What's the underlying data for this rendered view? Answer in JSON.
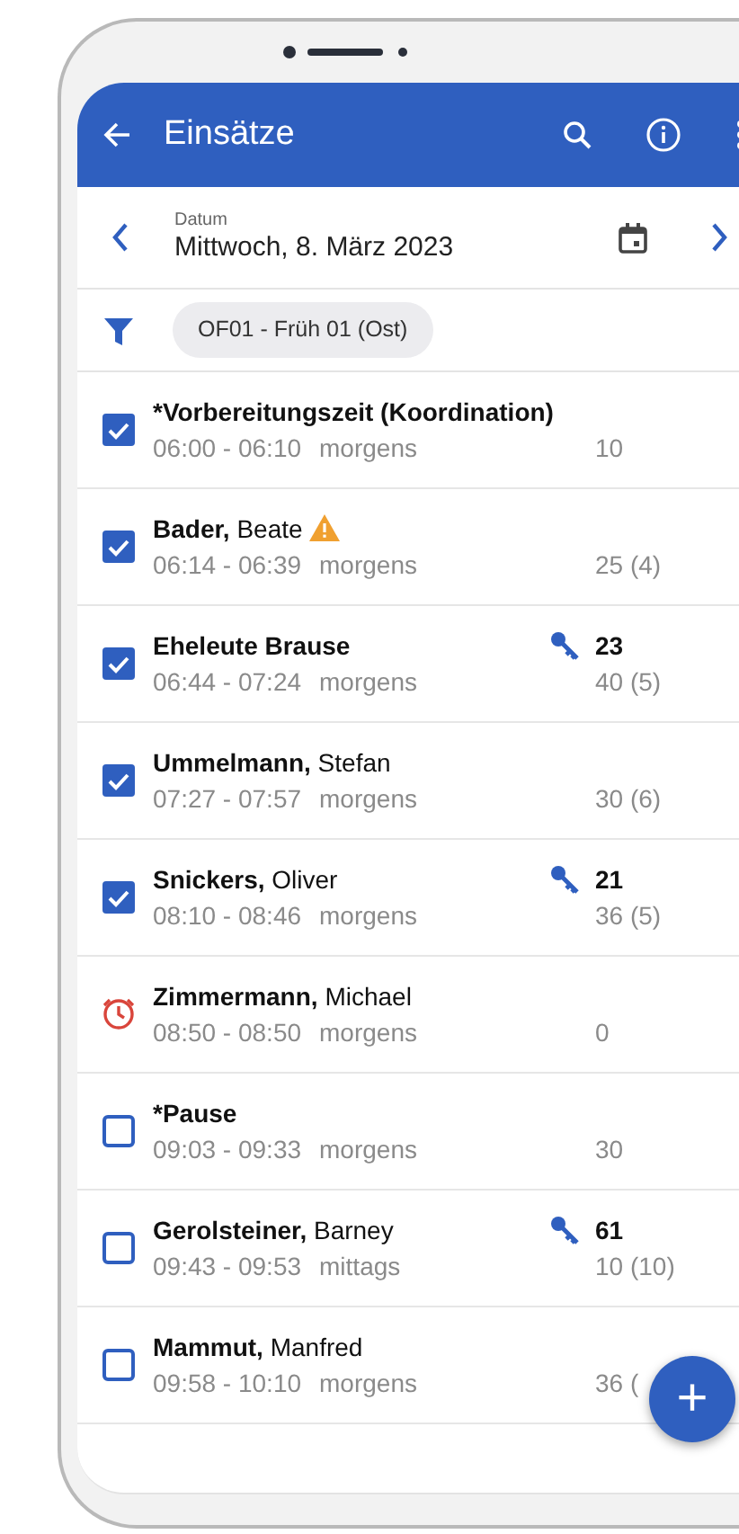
{
  "app_bar": {
    "title": "Einsätze"
  },
  "date_bar": {
    "label": "Datum",
    "value": "Mittwoch, 8. März 2023"
  },
  "filter": {
    "chip": "OF01 - Früh 01 (Ost)"
  },
  "items": [
    {
      "kind": "checkbox",
      "checked": true,
      "surname": "*Vorbereitungszeit (Koordination)",
      "time": "06:00 - 06:10",
      "period": "morgens",
      "duration": "10"
    },
    {
      "kind": "checkbox",
      "checked": true,
      "surname": "Bader,",
      "given": "Beate",
      "warning": true,
      "time": "06:14 - 06:39",
      "period": "morgens",
      "duration": "25 (4)"
    },
    {
      "kind": "checkbox",
      "checked": true,
      "surname": "Eheleute Brause",
      "key_number": "23",
      "time": "06:44 - 07:24",
      "period": "morgens",
      "duration": "40 (5)"
    },
    {
      "kind": "checkbox",
      "checked": true,
      "surname": "Ummelmann,",
      "given": "Stefan",
      "time": "07:27 - 07:57",
      "period": "morgens",
      "duration": "30 (6)"
    },
    {
      "kind": "checkbox",
      "checked": true,
      "surname": "Snickers,",
      "given": "Oliver",
      "key_number": "21",
      "time": "08:10 - 08:46",
      "period": "morgens",
      "duration": "36 (5)"
    },
    {
      "kind": "clock",
      "surname": "Zimmermann,",
      "given": "Michael",
      "time": "08:50 - 08:50",
      "period": "morgens",
      "duration": "0"
    },
    {
      "kind": "checkbox",
      "checked": false,
      "surname": "*Pause",
      "time": "09:03 - 09:33",
      "period": "morgens",
      "duration": "30"
    },
    {
      "kind": "checkbox",
      "checked": false,
      "surname": "Gerolsteiner,",
      "given": "Barney",
      "key_number": "61",
      "time": "09:43 - 09:53",
      "period": "mittags",
      "duration": "10 (10)"
    },
    {
      "kind": "checkbox",
      "checked": false,
      "surname": "Mammut,",
      "given": "Manfred",
      "time": "09:58 - 10:10",
      "period": "morgens",
      "duration": "36 ("
    }
  ],
  "fab": {
    "label": "+"
  }
}
